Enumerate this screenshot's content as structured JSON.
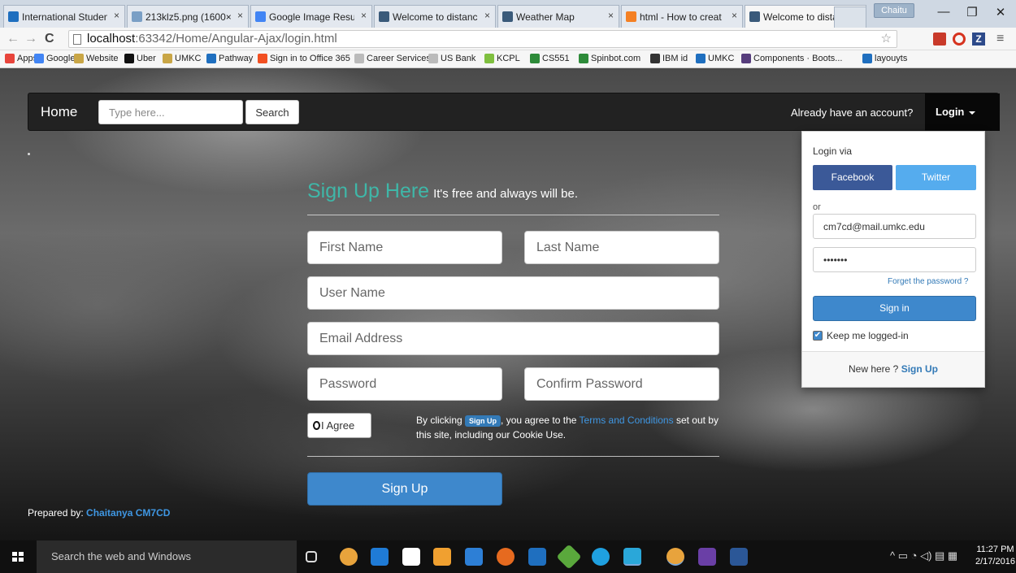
{
  "browser": {
    "tabs": [
      {
        "label": "International Studen",
        "color": "#1f6fbf"
      },
      {
        "label": "213klz5.png (1600×",
        "color": "#7a9fc5"
      },
      {
        "label": "Google Image Resul",
        "color": "#4285f4"
      },
      {
        "label": "Welcome to distanc",
        "color": "#3a5a7a"
      },
      {
        "label": "Weather Map",
        "color": "#3a5a7a"
      },
      {
        "label": "html - How to creat",
        "color": "#f48024"
      },
      {
        "label": "Welcome to distanc",
        "color": "#3a5a7a"
      }
    ],
    "user_badge": "Chaitu",
    "window_controls": {
      "minimize": "—",
      "maximize": "❐",
      "close": "✕"
    },
    "url_host": "localhost",
    "url_path": ":63342/Home/Angular-Ajax/login.html",
    "bookmarks": [
      {
        "label": "Apps",
        "color": "#e8453c"
      },
      {
        "label": "Google",
        "color": "#4285f4"
      },
      {
        "label": "Website",
        "color": "#c9a646"
      },
      {
        "label": "Uber",
        "color": "#111111"
      },
      {
        "label": "UMKC",
        "color": "#c9a646"
      },
      {
        "label": "Pathway",
        "color": "#1f6fbf"
      },
      {
        "label": "Sign in to Office 365",
        "color": "#f25022"
      },
      {
        "label": "Career Services",
        "color": "#bbbbbb"
      },
      {
        "label": "US Bank",
        "color": "#bbbbbb"
      },
      {
        "label": "KCPL",
        "color": "#7fbf3f"
      },
      {
        "label": "CS551",
        "color": "#2e8b3a"
      },
      {
        "label": "Spinbot.com",
        "color": "#2e8b3a"
      },
      {
        "label": "IBM id",
        "color": "#333333"
      },
      {
        "label": "UMKC",
        "color": "#1f6fbf"
      },
      {
        "label": "Components · Boots...",
        "color": "#563d7c"
      },
      {
        "label": "layouyts",
        "color": "#1f6fbf"
      }
    ]
  },
  "navbar": {
    "brand": "Home",
    "search_placeholder": "Type here...",
    "search_label": "Search",
    "account_text": "Already have an account?",
    "login_label": "Login"
  },
  "signup": {
    "heading_main": "Sign Up Here",
    "heading_sub": "It's free and always will be.",
    "first_name": "First Name",
    "last_name": "Last Name",
    "user_name": "User Name",
    "email": "Email Address",
    "password": "Password",
    "confirm_password": "Confirm Password",
    "agree_label": "I Agree",
    "terms_prefix": "By clicking ",
    "terms_badge": "Sign Up",
    "terms_middle": ", you agree to the ",
    "terms_link": "Terms and Conditions",
    "terms_suffix": " set out by this site, including our Cookie Use.",
    "submit_label": "Sign Up"
  },
  "footer": {
    "prepared_prefix": "Prepared by: ",
    "author": "Chaitanya CM7CD"
  },
  "login_dropdown": {
    "via_label": "Login via",
    "facebook": "Facebook",
    "twitter": "Twitter",
    "or": "or",
    "email_value": "cm7cd@mail.umkc.edu",
    "password_value": "•••••••",
    "forgot": "Forget the password ?",
    "signin": "Sign in",
    "keep_logged": "Keep me logged-in",
    "new_here": "New here ? ",
    "signup_link": "Sign Up"
  },
  "taskbar": {
    "search_placeholder": "Search the web and Windows",
    "icons": [
      {
        "name": "task-view-icon",
        "color": "#101010"
      },
      {
        "name": "chrome-icon",
        "color": "#e8a33c"
      },
      {
        "name": "edge-icon",
        "color": "#1f7bd6"
      },
      {
        "name": "store-icon",
        "color": "#ffffff"
      },
      {
        "name": "outlook-icon",
        "color": "#f0a030"
      },
      {
        "name": "file-explorer-icon",
        "color": "#2d7fd6"
      },
      {
        "name": "firefox-icon",
        "color": "#e66a1f"
      },
      {
        "name": "media-player-icon",
        "color": "#1f6fbf"
      },
      {
        "name": "git-icon",
        "color": "#5aa83c"
      },
      {
        "name": "skype-icon",
        "color": "#1fa0e0"
      },
      {
        "name": "webstorm-icon",
        "color": "#2aa7d9"
      },
      {
        "name": "chrome-icon-2",
        "color": "#e8a33c"
      },
      {
        "name": "visual-studio-icon",
        "color": "#6a3fa6"
      },
      {
        "name": "word-icon",
        "color": "#2b5797"
      }
    ],
    "tray_icons": "^ ▭ ◔ ◁) ▤ ▦",
    "time": "11:27 PM",
    "date": "2/17/2016"
  }
}
